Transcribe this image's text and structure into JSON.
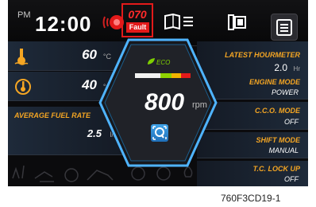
{
  "header": {
    "period": "PM",
    "time": "12:00",
    "fault_code": "070",
    "fault_label": "Fault"
  },
  "left": {
    "temp1": {
      "value": "60",
      "unit": "°C"
    },
    "temp2": {
      "value": "40",
      "unit": "°C"
    },
    "fuel_rate": {
      "title": "AVERAGE FUEL RATE",
      "value": "2.5",
      "unit": "l/h"
    }
  },
  "center": {
    "eco_label": "ECO",
    "rpm_value": "800",
    "rpm_unit": "rpm",
    "mode_icon_label": "Q"
  },
  "right": {
    "hourmeter": {
      "title": "LATEST HOURMETER",
      "value": "2.0",
      "unit": "Hr"
    },
    "engine_mode": {
      "title": "ENGINE MODE",
      "value": "POWER"
    },
    "cco_mode": {
      "title": "C.C.O. MODE",
      "value": "OFF"
    },
    "shift_mode": {
      "title": "SHIFT MODE",
      "value": "MANUAL"
    },
    "tc_lockup": {
      "title": "T.C. LOCK UP",
      "value": "OFF"
    }
  },
  "caption": "760F3CD19-1",
  "colors": {
    "accent": "#f5a623",
    "fault": "#e31a1a",
    "eco": "#7fd000",
    "glow": "#4fb4ff"
  },
  "icons": [
    "alarm-icon",
    "book-icon",
    "camera-switch-icon",
    "menu-icon",
    "coolant-temp-icon",
    "hydraulic-temp-icon"
  ]
}
